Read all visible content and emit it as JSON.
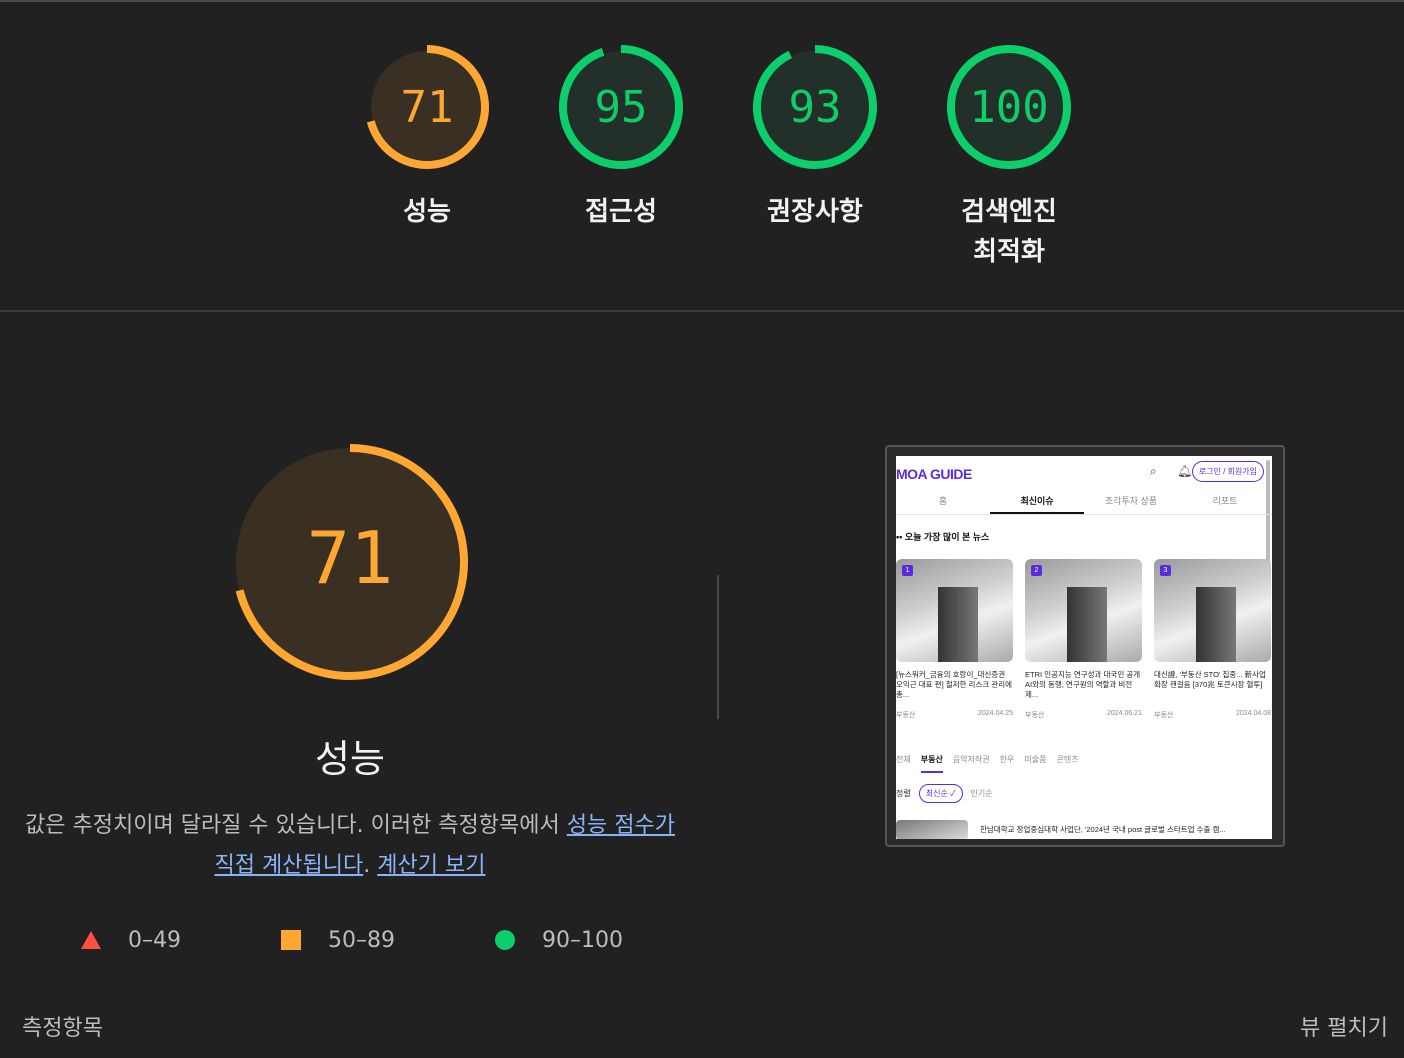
{
  "colors": {
    "orange": "#ffa733",
    "orange_bg": "#3a2f23",
    "green": "#0cce6b",
    "green_bg": "#23302a",
    "red": "#ff4e42",
    "link": "#8ab4f8"
  },
  "categories": [
    {
      "score": "71",
      "label": "성능",
      "color": "orange",
      "fraction": 0.71
    },
    {
      "score": "95",
      "label": "접근성",
      "color": "green",
      "fraction": 0.95
    },
    {
      "score": "93",
      "label": "권장사항",
      "color": "green",
      "fraction": 0.93
    },
    {
      "score": "100",
      "label": "검색엔진\n최적화",
      "color": "green",
      "fraction": 1.0
    }
  ],
  "performance": {
    "score": "71",
    "fraction": 0.71,
    "title": "성능",
    "desc_prefix": "값은 추정치이며 달라질 수 있습니다. 이러한 측정항목에서 ",
    "desc_link1": "성능 점수가 직접 계산됩니다",
    "desc_mid": ". ",
    "desc_link2": "계산기 보기"
  },
  "legend": {
    "fail": "0–49",
    "average": "50–89",
    "pass": "90–100"
  },
  "screenshot": {
    "brand": "MOA GUIDE",
    "login_button": "로그인 / 회원가입",
    "nav_tabs": [
      "홈",
      "최신이슈",
      "조각투자 상품",
      "리포트"
    ],
    "active_tab": "최신이슈",
    "news_heading": "오늘 가장 많이 본 뉴스",
    "cards": [
      {
        "rank": "1",
        "title": "[뉴스워커_금융의 호랑이_대신증권 오익근 대표 편] 철저한 리스크 관리에 총...",
        "category": "부동산",
        "date": "2024.04.25"
      },
      {
        "rank": "2",
        "title": "ETRI 인공지능 연구성과 대국민 공개 AI와의 동행, 연구원의 역할과 비전 제...",
        "category": "부동산",
        "date": "2024.06.21"
      },
      {
        "rank": "3",
        "title": "대신證, '부동산 STO' 집중... 新사업 확장 잰걸음 [370兆 토큰시장 혈투]",
        "category": "부동산",
        "date": "2024.04.08"
      }
    ],
    "category_tabs": [
      "전체",
      "부동산",
      "음악저작권",
      "한우",
      "미술품",
      "콘텐츠"
    ],
    "active_category": "부동산",
    "sort_label": "정렬",
    "sort_latest": "최신순 ✓",
    "sort_popular": "인기순",
    "bottom_item": "한남대학교 창업중심대학 사업단, '2024년 국내 post 글로벌 스타트업 수출 캠..."
  },
  "footer": {
    "metrics_label": "측정항목",
    "expand_view": "뷰 펼치기"
  }
}
